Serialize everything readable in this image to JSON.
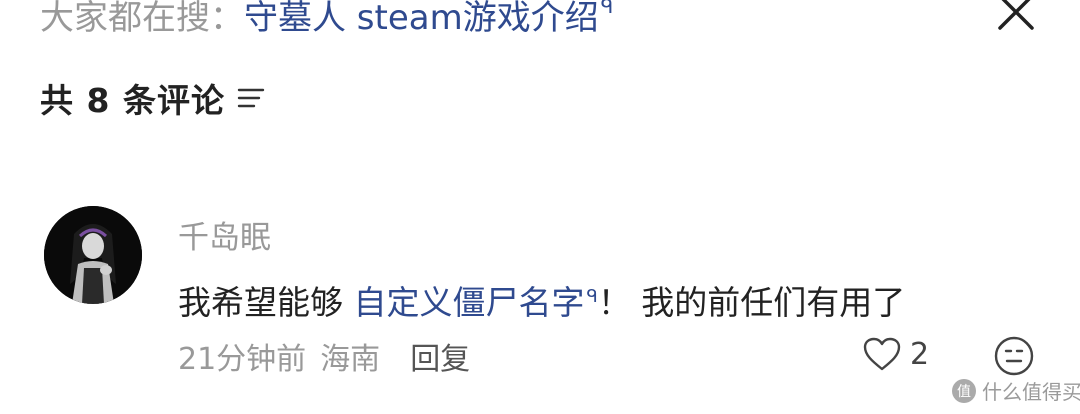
{
  "search": {
    "prefix": "大家都在搜：",
    "query": "守墓人 steam游戏介绍",
    "search_mark": "ᑫ"
  },
  "header": {
    "comment_count_label": "共 8 条评论"
  },
  "comment": {
    "username": "千岛眠",
    "text_before": "我希望能够 ",
    "link_text": "自定义僵尸名字",
    "link_mark": "ᑫ",
    "text_after": "！ 我的前任们有用了",
    "time": "21分钟前",
    "location": "海南",
    "reply_label": "回复",
    "like_count": "2"
  },
  "watermark": {
    "text": "什么值得买"
  },
  "colors": {
    "link": "#2f4a8f",
    "muted": "#999999",
    "text": "#222222",
    "watermark_logo": "#aaaaaa"
  },
  "icons": {
    "close": "close-icon",
    "sort": "sort-icon",
    "like": "heart-icon",
    "emoji": "emoji-icon",
    "avatar": "avatar-image"
  }
}
